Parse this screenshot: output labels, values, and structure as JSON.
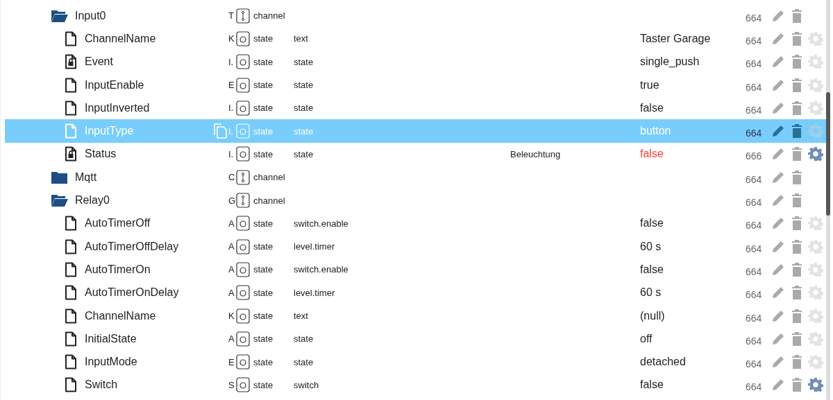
{
  "tree": [
    {
      "kind": "folder",
      "expanded": true,
      "name": "Input0",
      "col2": "T",
      "type": "channel",
      "acl": "664",
      "selected": false,
      "children": [
        {
          "kind": "file",
          "name": "ChannelName",
          "col2": "K",
          "type": "state",
          "role": "text",
          "value": "Taster Garage",
          "ack": true,
          "acl": "664",
          "custom_settings": false,
          "selected": false
        },
        {
          "kind": "locked",
          "name": "Event",
          "col2": "I.",
          "type": "state",
          "role": "state",
          "value": "single_push",
          "ack": true,
          "acl": "664",
          "custom_settings": false,
          "selected": false
        },
        {
          "kind": "file",
          "name": "InputEnable",
          "col2": "E",
          "type": "state",
          "role": "state",
          "value": "true",
          "ack": true,
          "acl": "664",
          "custom_settings": false,
          "selected": false
        },
        {
          "kind": "file",
          "name": "InputInverted",
          "col2": "I.",
          "type": "state",
          "role": "state",
          "value": "false",
          "ack": true,
          "acl": "664",
          "custom_settings": false,
          "selected": false
        },
        {
          "kind": "file",
          "name": "InputType",
          "col2": "I.",
          "type": "state",
          "role": "state",
          "value": "button",
          "ack": true,
          "acl": "664",
          "custom_settings": false,
          "selected": true
        },
        {
          "kind": "locked",
          "name": "Status",
          "col2": "I.",
          "type": "state",
          "role": "state",
          "room": "Beleuchtung",
          "value": "false",
          "ack": false,
          "acl": "666",
          "custom_settings": true,
          "selected": false
        }
      ]
    },
    {
      "kind": "folder",
      "expanded": false,
      "name": "Mqtt",
      "col2": "C",
      "type": "channel",
      "acl": "664",
      "selected": false
    },
    {
      "kind": "folder",
      "expanded": true,
      "name": "Relay0",
      "col2": "G",
      "type": "channel",
      "acl": "664",
      "selected": false,
      "children": [
        {
          "kind": "file",
          "name": "AutoTimerOff",
          "col2": "A",
          "type": "state",
          "role": "switch.enable",
          "value": "false",
          "ack": true,
          "acl": "664",
          "custom_settings": false,
          "selected": false
        },
        {
          "kind": "file",
          "name": "AutoTimerOffDelay",
          "col2": "A",
          "type": "state",
          "role": "level.timer",
          "value": "60 s",
          "ack": true,
          "acl": "664",
          "custom_settings": false,
          "selected": false
        },
        {
          "kind": "file",
          "name": "AutoTimerOn",
          "col2": "A",
          "type": "state",
          "role": "switch.enable",
          "value": "false",
          "ack": true,
          "acl": "664",
          "custom_settings": false,
          "selected": false
        },
        {
          "kind": "file",
          "name": "AutoTimerOnDelay",
          "col2": "A",
          "type": "state",
          "role": "level.timer",
          "value": "60 s",
          "ack": true,
          "acl": "664",
          "custom_settings": false,
          "selected": false
        },
        {
          "kind": "file",
          "name": "ChannelName",
          "col2": "K",
          "type": "state",
          "role": "text",
          "value": "(null)",
          "ack": true,
          "acl": "664",
          "custom_settings": false,
          "selected": false
        },
        {
          "kind": "file",
          "name": "InitialState",
          "col2": "A",
          "type": "state",
          "role": "state",
          "value": "off",
          "ack": true,
          "acl": "664",
          "custom_settings": false,
          "selected": false
        },
        {
          "kind": "file",
          "name": "InputMode",
          "col2": "E",
          "type": "state",
          "role": "state",
          "value": "detached",
          "ack": true,
          "acl": "664",
          "custom_settings": false,
          "selected": false
        },
        {
          "kind": "file",
          "name": "Switch",
          "col2": "S",
          "type": "state",
          "role": "switch",
          "value": "false",
          "ack": true,
          "acl": "664",
          "custom_settings": true,
          "selected": false
        }
      ]
    }
  ]
}
